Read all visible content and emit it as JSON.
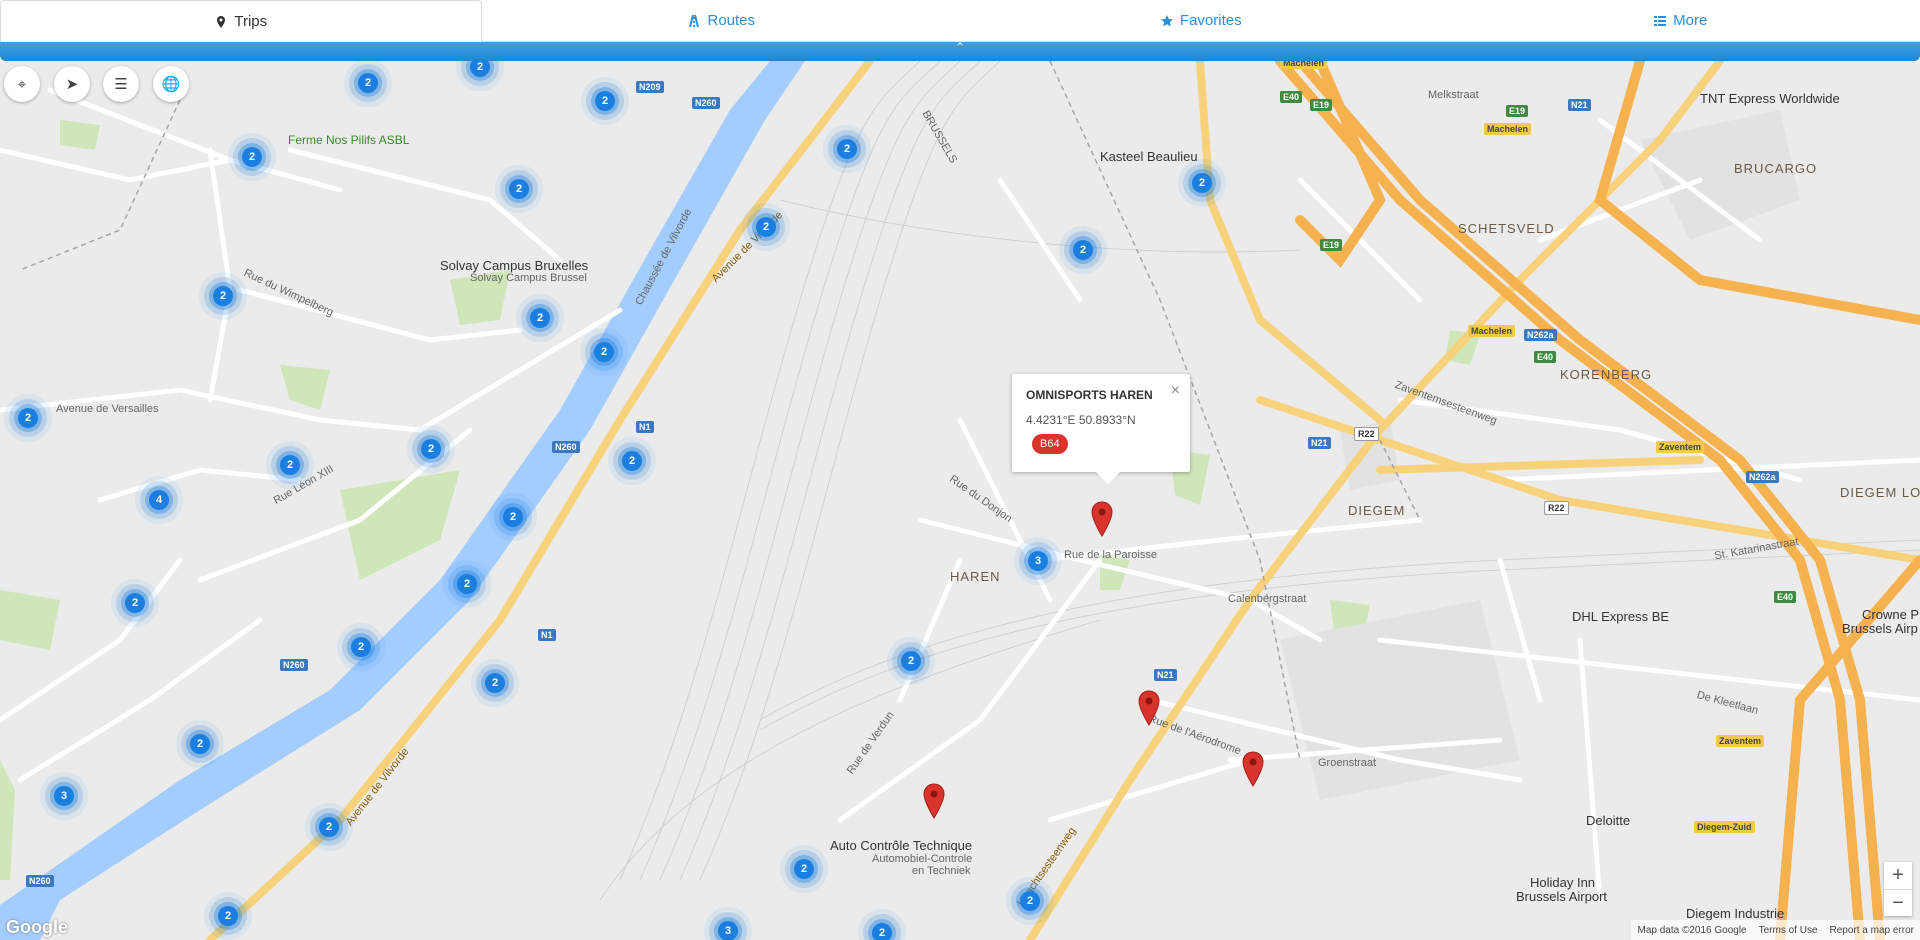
{
  "tabs": [
    {
      "label": "Trips",
      "icon": "map-marker-icon",
      "active": true
    },
    {
      "label": "Routes",
      "icon": "road-icon",
      "active": false
    },
    {
      "label": "Favorites",
      "icon": "star-icon",
      "active": false
    },
    {
      "label": "More",
      "icon": "list-icon",
      "active": false
    }
  ],
  "toggle_glyph": "⌃",
  "controls": [
    {
      "icon": "crosshair-icon",
      "glyph": "⌖"
    },
    {
      "icon": "send-icon",
      "glyph": "➤"
    },
    {
      "icon": "layers-icon",
      "glyph": "☰"
    },
    {
      "icon": "globe-icon",
      "glyph": "🌐"
    }
  ],
  "popup": {
    "title": "OMNISPORTS HAREN",
    "coords": "4.4231°E  50.8933°N",
    "badge": "B64",
    "close": "×"
  },
  "clusters": [
    "2",
    "2",
    "2",
    "2",
    "2",
    "2",
    "2",
    "2",
    "2",
    "2",
    "2",
    "2",
    "2",
    "2",
    "2",
    "4",
    "2",
    "2",
    "2",
    "3",
    "2",
    "2",
    "2",
    "2",
    "2",
    "3",
    "2",
    "2",
    "2",
    "3",
    "2",
    "2"
  ],
  "place_labels": {
    "brucargo": "BRUCARGO",
    "schetsveld": "SCHETSVELD",
    "korenberg": "KORENBERG",
    "diegem": "DIEGEM",
    "diegem_lo": "DIEGEM LO",
    "haren": "HAREN",
    "brussels": "BRUSSELS"
  },
  "poi_labels": {
    "ferme": "Ferme Nos Pilifs ASBL",
    "solvay1": "Solvay Campus Bruxelles",
    "solvay2": "Solvay Campus Brussel",
    "kasteel": "Kasteel Beaulieu",
    "tnt": "TNT Express Worldwide",
    "dhl": "DHL Express BE",
    "crowne1": "Crowne Pla",
    "crowne2": "Brussels Airp",
    "deloitte": "Deloitte",
    "holiday1": "Holiday Inn",
    "holiday2": "Brussels Airport",
    "diegem_ind": "Diegem Industrie",
    "auto1": "Auto Contrôle Technique",
    "auto2": "Automobiel-Controle",
    "auto3": "en Techniek"
  },
  "road_labels": {
    "vilvorde1": "Avenue de Vilvorde",
    "vilvorde2": "Avenue de Vilvorde",
    "chaussee": "Chaussée de Vilvorde",
    "versailles": "Avenue de Versailles",
    "paroisse": "Rue de la Paroisse",
    "aerodrome": "Rue de l'Aérodrome",
    "groenstraat": "Groenstraat",
    "calenberg": "Calenbergstraat",
    "melkstraat": "Melkstraat",
    "zaventem": "Zaventemsesteenweg",
    "wimpelberg": "Rue du Wimpelberg",
    "leon": "Rue Léon XIII",
    "donjon": "Rue du Donjon",
    "verdun": "Rue de Verdun",
    "haecht": "Haachtsesteenweg",
    "stkatarina": "St. Katarinastraat",
    "kleetlaan": "De Kleetlaan"
  },
  "shields": {
    "n209": "N209",
    "n260a": "N260",
    "n260b": "N260",
    "n260c": "N260",
    "n260d": "N260",
    "n1a": "N1",
    "n1b": "N1",
    "n21a": "N21",
    "n21b": "N21",
    "n21c": "N21",
    "r22a": "R22",
    "r22b": "R22",
    "n262a": "N262a",
    "n262b": "N262a",
    "e40a": "E40",
    "e40b": "E40",
    "e40c": "E40",
    "e19a": "E19",
    "e19b": "E19",
    "e19c": "E19",
    "machelen1": "Machelen",
    "machelen2": "Machelen",
    "machelen3": "Machelen",
    "zav1": "Zaventem",
    "zav2": "Zaventem",
    "diegemzuid": "Diegem-Zuid"
  },
  "attribution": [
    "Map data ©2016 Google",
    "Terms of Use",
    "Report a map error"
  ],
  "google_logo": "Google",
  "zoom": {
    "in": "+",
    "out": "−"
  },
  "colors": {
    "accent": "#2a8fd8",
    "cluster": "#1a7fe0",
    "pin": "#d9342b",
    "water": "#a3ccff",
    "highway": "#f7c56b"
  }
}
